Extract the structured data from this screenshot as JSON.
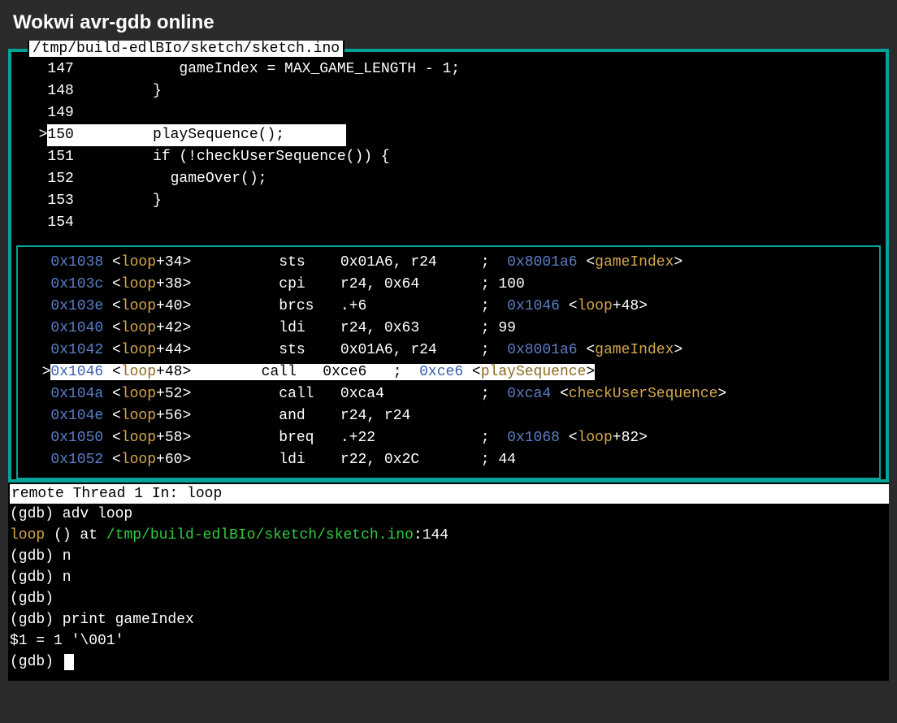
{
  "header": {
    "title": "Wokwi avr-gdb online"
  },
  "source": {
    "file": "/tmp/build-edlBIo/sketch/sketch.ino",
    "lines": [
      {
        "num": "147",
        "text": "           gameIndex = MAX_GAME_LENGTH - 1;"
      },
      {
        "num": "148",
        "text": "        }"
      },
      {
        "num": "149",
        "text": ""
      },
      {
        "num": "150",
        "text": "        playSequence();",
        "current": true
      },
      {
        "num": "151",
        "text": "        if (!checkUserSequence()) {"
      },
      {
        "num": "152",
        "text": "          gameOver();"
      },
      {
        "num": "153",
        "text": "        }"
      },
      {
        "num": "154",
        "text": ""
      }
    ]
  },
  "asm": {
    "lines": [
      {
        "addr": "0x1038",
        "sym": "loop",
        "off": "34",
        "op": "sts",
        "args": "0x01A6, r24",
        "c": "0x8001a6",
        "csym": "gameIndex"
      },
      {
        "addr": "0x103c",
        "sym": "loop",
        "off": "38",
        "op": "cpi",
        "args": "r24, 0x64",
        "c": "100"
      },
      {
        "addr": "0x103e",
        "sym": "loop",
        "off": "40",
        "op": "brcs",
        "args": ".+6",
        "c": "0x1046",
        "csym": "loop",
        "coff": "48"
      },
      {
        "addr": "0x1040",
        "sym": "loop",
        "off": "42",
        "op": "ldi",
        "args": "r24, 0x63",
        "c": "99"
      },
      {
        "addr": "0x1042",
        "sym": "loop",
        "off": "44",
        "op": "sts",
        "args": "0x01A6, r24",
        "c": "0x8001a6",
        "csym": "gameIndex"
      },
      {
        "addr": "0x1046",
        "sym": "loop",
        "off": "48",
        "op": "call",
        "args": "0xce6",
        "c": "0xce6",
        "csym": "playSequence",
        "current": true
      },
      {
        "addr": "0x104a",
        "sym": "loop",
        "off": "52",
        "op": "call",
        "args": "0xca4",
        "c": "0xca4",
        "csym": "checkUserSequence"
      },
      {
        "addr": "0x104e",
        "sym": "loop",
        "off": "56",
        "op": "and",
        "args": "r24, r24"
      },
      {
        "addr": "0x1050",
        "sym": "loop",
        "off": "58",
        "op": "breq",
        "args": ".+22",
        "c": "0x1068",
        "csym": "loop",
        "coff": "82"
      },
      {
        "addr": "0x1052",
        "sym": "loop",
        "off": "60",
        "op": "ldi",
        "args": "r22, 0x2C",
        "c": "44"
      }
    ]
  },
  "console": {
    "status": "remote Thread 1 In: loop",
    "lines": [
      {
        "t": "prompt",
        "text": "(gdb) adv loop"
      },
      {
        "t": "loc",
        "fn": "loop",
        "mid": " () at ",
        "path": "/tmp/build-edlBIo/sketch/sketch.ino",
        "line": ":144"
      },
      {
        "t": "prompt",
        "text": "(gdb) n"
      },
      {
        "t": "prompt",
        "text": "(gdb) n"
      },
      {
        "t": "prompt",
        "text": "(gdb) "
      },
      {
        "t": "prompt",
        "text": "(gdb) print gameIndex"
      },
      {
        "t": "plain",
        "text": "$1 = 1 '\\001'"
      },
      {
        "t": "cursor",
        "text": "(gdb) "
      }
    ]
  }
}
